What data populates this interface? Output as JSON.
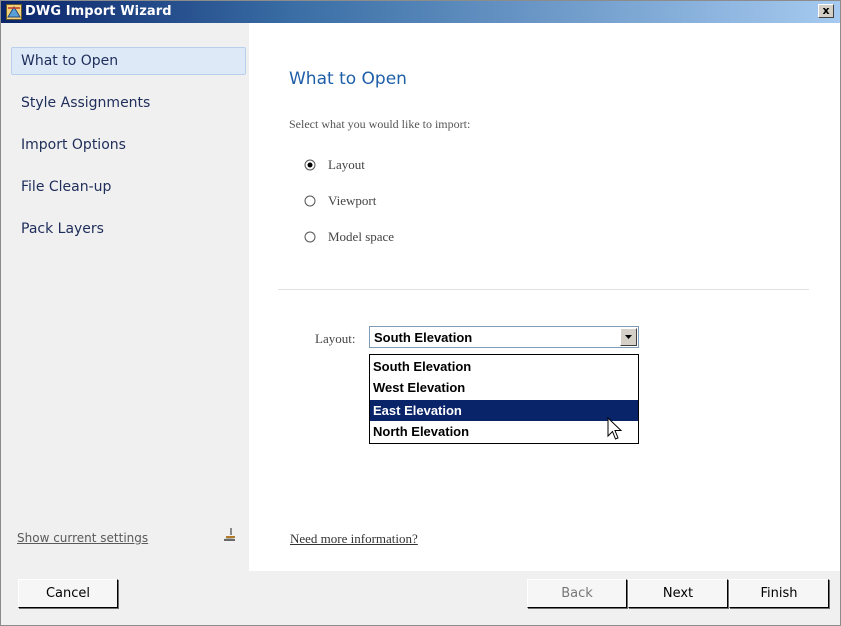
{
  "window": {
    "title": "DWG Import Wizard",
    "close_label": "x"
  },
  "sidebar": {
    "items": [
      {
        "label": "What to Open",
        "active": true
      },
      {
        "label": "Style Assignments",
        "active": false
      },
      {
        "label": "Import Options",
        "active": false
      },
      {
        "label": "File Clean-up",
        "active": false
      },
      {
        "label": "Pack Layers",
        "active": false
      }
    ],
    "show_settings_label": "Show current settings"
  },
  "main": {
    "title": "What to Open",
    "prompt": "Select what you would like to import:",
    "options": [
      {
        "label": "Layout",
        "selected": true
      },
      {
        "label": "Viewport",
        "selected": false
      },
      {
        "label": "Model space",
        "selected": false
      }
    ],
    "layout_label": "Layout:",
    "layout_value": "South Elevation",
    "layout_options": [
      "South Elevation",
      "West Elevation",
      "East Elevation",
      "North Elevation"
    ],
    "highlighted_option": "East Elevation",
    "more_info_label": "Need more information?"
  },
  "footer": {
    "cancel_label": "Cancel",
    "back_label": "Back",
    "next_label": "Next",
    "finish_label": "Finish"
  },
  "colors": {
    "title_accent": "#1f5fa8",
    "highlight": "#0a246a",
    "sidebar_active": "#dde9f7"
  }
}
